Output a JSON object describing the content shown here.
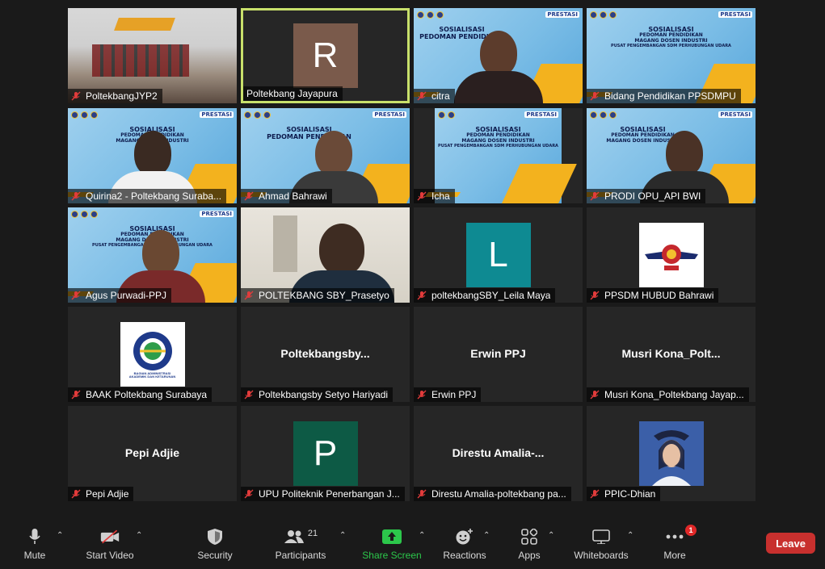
{
  "tiles": [
    {
      "name": "PoltekbangJYP2"
    },
    {
      "name": "Poltekbang Jayapura",
      "initial": "R"
    },
    {
      "name": "citra"
    },
    {
      "name": "Bidang Pendidikan PPSDMPU"
    },
    {
      "name": "Quirina2 - Poltekbang Suraba..."
    },
    {
      "name": "Ahmad Bahrawi"
    },
    {
      "name": "Icha"
    },
    {
      "name": "PRODI OPU_API BWI"
    },
    {
      "name": "Agus Purwadi-PPJ"
    },
    {
      "name": "POLTEKBANG SBY_Prasetyo"
    },
    {
      "name": "poltekbangSBY_Leila Maya",
      "initial": "L"
    },
    {
      "name": "PPSDM HUBUD Bahrawi"
    },
    {
      "name": "BAAK Poltekbang Surabaya"
    },
    {
      "name": "Poltekbangsby Setyo Hariyadi",
      "display": "Poltekbangsby..."
    },
    {
      "name": "Erwin PPJ",
      "display": "Erwin PPJ"
    },
    {
      "name": "Musri Kona_Poltekbang Jayap...",
      "display": "Musri  Kona_Polt..."
    },
    {
      "name": "Pepi Adjie",
      "display": "Pepi Adjie"
    },
    {
      "name": "UPU Politeknik Penerbangan J...",
      "initial": "P"
    },
    {
      "name": "Direstu Amalia-poltekbang pa...",
      "display": "Direstu  Amalia-..."
    },
    {
      "name": "PPIC-Dhian"
    }
  ],
  "slide": {
    "line1": "SOSIALISASI",
    "line2": "PEDOMAN PENDIDIKAN",
    "line3": "MAGANG DOSEN INDUSTRI",
    "line4": "PUSAT PENGEMBANGAN SDM PERHUBUNGAN UDARA",
    "badge": "PRESTASI"
  },
  "baak_logo": {
    "line1": "BAGIAN ADMINISTRASI",
    "line2": "AKADEMIK DAN KETARUNAN"
  },
  "toolbar": {
    "mute": "Mute",
    "start_video": "Start Video",
    "security": "Security",
    "participants": "Participants",
    "participants_count": "21",
    "share_screen": "Share Screen",
    "reactions": "Reactions",
    "apps": "Apps",
    "whiteboards": "Whiteboards",
    "more": "More",
    "more_badge": "1",
    "leave": "Leave"
  },
  "colors": {
    "active_speaker": "#c8e06b",
    "avatar_R": "#7a5a4b",
    "avatar_L": "#0e8a92",
    "avatar_P": "#0d5a45",
    "share_green": "#2cc74b",
    "leave_red": "#c8302e"
  }
}
